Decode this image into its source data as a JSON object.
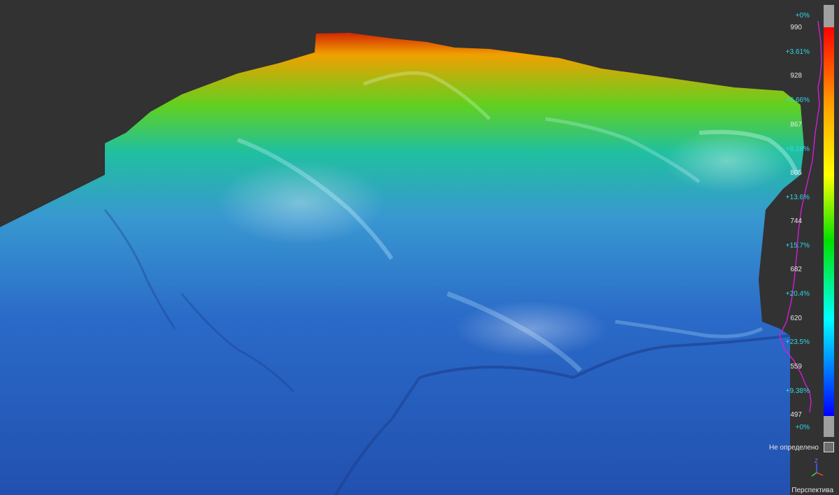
{
  "scale": {
    "elevation_labels": [
      "990",
      "928",
      "867",
      "805",
      "744",
      "682",
      "620",
      "559",
      "497"
    ],
    "percent_labels": [
      "+0%",
      "+3.61%",
      "+6.66%",
      "+8.18%",
      "+13.6%",
      "+15.7%",
      "+20.4%",
      "+23.5%",
      "+9.38%",
      "+0%"
    ],
    "histogram_curve_color": "#d21ed2",
    "ramp_colors": [
      "#ff0000",
      "#ffa000",
      "#ffff00",
      "#00e000",
      "#00ffff",
      "#0000ff"
    ],
    "clip_colors": [
      "#a0a0a0",
      "#a0a0a0"
    ]
  },
  "undefined_label": "Не определено",
  "projection_label": "Перспектива",
  "axis_gizmo": {
    "z_label": "Z"
  },
  "terrain": {
    "background": "#323232",
    "gradient_colors": [
      "#d02000",
      "#f0a000",
      "#60d020",
      "#20c0a0",
      "#3898d0",
      "#2a6ac8",
      "#2250b0"
    ]
  }
}
